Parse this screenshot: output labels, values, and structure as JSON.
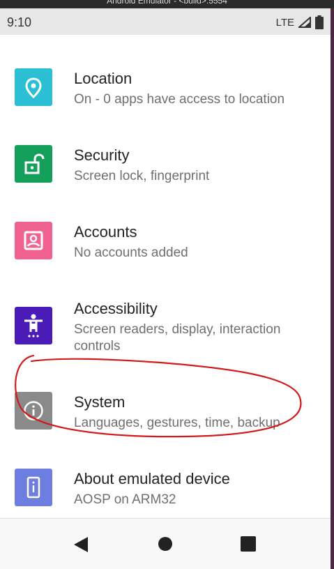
{
  "window": {
    "title": "Android Emulator - <build>:5554"
  },
  "status_bar": {
    "time": "9:10",
    "network": "LTE"
  },
  "settings": [
    {
      "title": "Location",
      "subtitle": "On - 0 apps have access to location",
      "icon": "location-icon",
      "color": "#2bbfd4"
    },
    {
      "title": "Security",
      "subtitle": "Screen lock, fingerprint",
      "icon": "lock-icon",
      "color": "#14a05a"
    },
    {
      "title": "Accounts",
      "subtitle": "No accounts added",
      "icon": "account-icon",
      "color": "#f0628f"
    },
    {
      "title": "Accessibility",
      "subtitle": "Screen readers, display, interaction controls",
      "icon": "accessibility-icon",
      "color": "#4a1bb7"
    },
    {
      "title": "System",
      "subtitle": "Languages, gestures, time, backup",
      "icon": "info-icon",
      "color": "#8a8a8a"
    },
    {
      "title": "About emulated device",
      "subtitle": "AOSP on ARM32",
      "icon": "phone-info-icon",
      "color": "#6e7de0"
    }
  ],
  "nav": {
    "back": "back-icon",
    "home": "home-icon",
    "recents": "recents-icon"
  },
  "annotation": {
    "color": "#d21a1a"
  }
}
